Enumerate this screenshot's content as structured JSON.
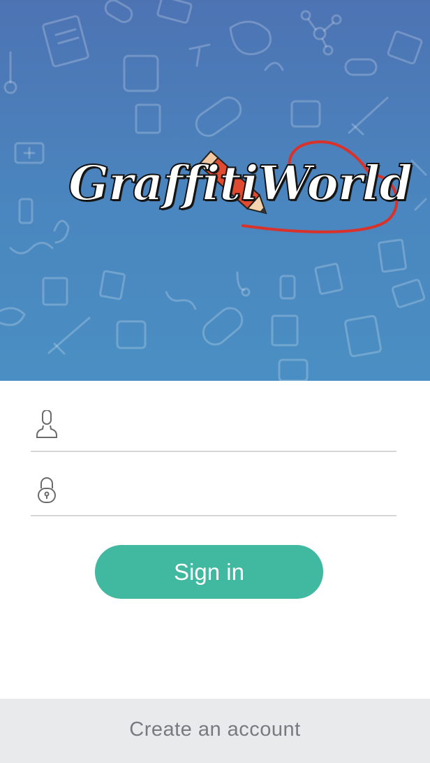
{
  "brand": {
    "logo_text": "GraffitiWorld"
  },
  "login_form": {
    "username_placeholder": "",
    "username_value": "",
    "password_placeholder": "",
    "password_value": ""
  },
  "actions": {
    "signin_label": "Sign in",
    "create_account_label": "Create an account"
  },
  "colors": {
    "header_top": "#4d73b3",
    "header_bottom": "#4a8fc3",
    "accent": "#41b8a0",
    "footer_bg": "#e9eaec",
    "logo_heart": "#d8322a"
  },
  "icons": {
    "username": "user-icon",
    "password": "lock-icon",
    "background_pattern": "medical-doodle-pattern"
  }
}
